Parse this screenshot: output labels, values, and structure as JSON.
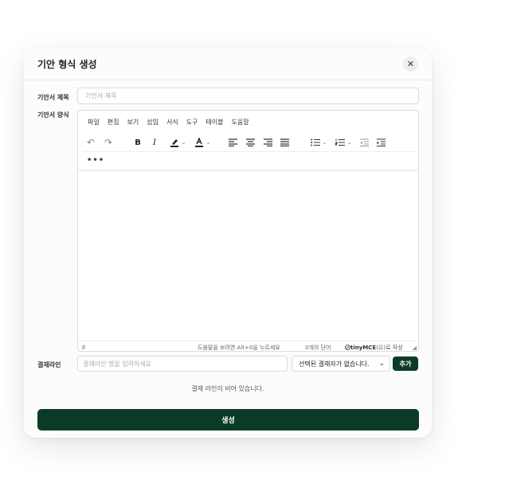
{
  "modal": {
    "title": "기안 형식 생성",
    "close_glyph": "✕"
  },
  "form": {
    "title_label": "기안서 제목",
    "title_placeholder": "기안서 제목",
    "format_label": "기안서 양식",
    "approval_label": "결재라인",
    "approval_placeholder": "결재라인 명을 입력하세요",
    "select_value": "선택된 결재자가 없습니다.",
    "add_label": "추가",
    "empty_message": "결재 라인이 비어 있습니다.",
    "create_label": "생성"
  },
  "editor": {
    "menu": [
      "파일",
      "편집",
      "보기",
      "삽입",
      "서식",
      "도구",
      "테이블",
      "도움말"
    ],
    "toolbar_icons": [
      "undo-icon",
      "redo-icon",
      "bold-icon",
      "italic-icon",
      "highlight-icon",
      "text-color-icon",
      "align-left-icon",
      "align-center-icon",
      "align-right-icon",
      "align-justify-icon",
      "bullet-list-icon",
      "numbered-list-icon",
      "outdent-icon",
      "indent-icon"
    ],
    "toolbar_glyphs": {
      "undo": "↶",
      "redo": "↷",
      "bold": "B",
      "italic": "I",
      "chev": "⌄"
    },
    "more_glyph": "•••",
    "status_path": "p",
    "status_help": "도움말을 보려면 Alt+0을 누르세요",
    "status_words": "0개의 단어",
    "status_brand_logo": "tinyMCE",
    "status_brand_suffix": "(으)로 작성",
    "accent_color": "#0b3b26"
  }
}
